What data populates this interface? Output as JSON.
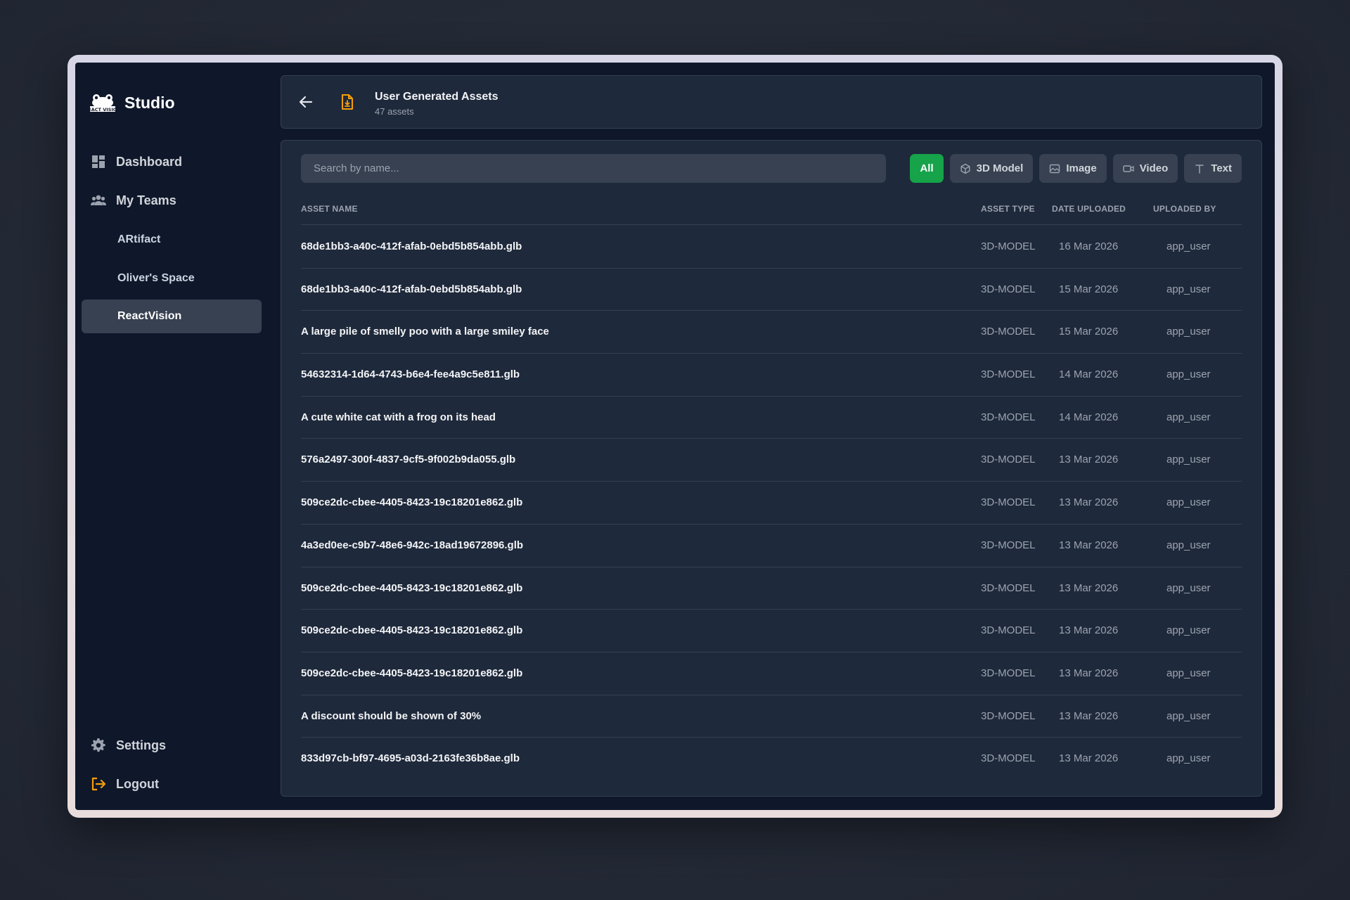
{
  "brand": {
    "name": "Studio",
    "logo_icon": "reactvision-logo"
  },
  "sidebar": {
    "nav": [
      {
        "label": "Dashboard",
        "icon": "dashboard-icon"
      },
      {
        "label": "My Teams",
        "icon": "teams-icon"
      }
    ],
    "teams": [
      {
        "label": "ARtifact",
        "active": false
      },
      {
        "label": "Oliver's Space",
        "active": false
      },
      {
        "label": "ReactVision",
        "active": true
      }
    ],
    "footer": [
      {
        "label": "Settings",
        "icon": "gear-icon"
      },
      {
        "label": "Logout",
        "icon": "logout-icon"
      }
    ]
  },
  "header": {
    "title": "User Generated Assets",
    "subtitle": "47 assets"
  },
  "search": {
    "placeholder": "Search by name...",
    "value": ""
  },
  "filters": [
    {
      "label": "All",
      "icon": "",
      "active": true
    },
    {
      "label": "3D Model",
      "icon": "cube-icon",
      "active": false
    },
    {
      "label": "Image",
      "icon": "image-icon",
      "active": false
    },
    {
      "label": "Video",
      "icon": "video-icon",
      "active": false
    },
    {
      "label": "Text",
      "icon": "text-icon",
      "active": false
    }
  ],
  "table": {
    "columns": [
      "ASSET NAME",
      "ASSET TYPE",
      "DATE UPLOADED",
      "UPLOADED BY"
    ],
    "rows": [
      {
        "name": "68de1bb3-a40c-412f-afab-0ebd5b854abb.glb",
        "type": "3D-MODEL",
        "date": "16 Mar 2026",
        "user": "app_user"
      },
      {
        "name": "68de1bb3-a40c-412f-afab-0ebd5b854abb.glb",
        "type": "3D-MODEL",
        "date": "15 Mar 2026",
        "user": "app_user"
      },
      {
        "name": "A large pile of smelly poo with a large smiley face",
        "type": "3D-MODEL",
        "date": "15 Mar 2026",
        "user": "app_user"
      },
      {
        "name": "54632314-1d64-4743-b6e4-fee4a9c5e811.glb",
        "type": "3D-MODEL",
        "date": "14 Mar 2026",
        "user": "app_user"
      },
      {
        "name": "A cute white cat with a frog on its head",
        "type": "3D-MODEL",
        "date": "14 Mar 2026",
        "user": "app_user"
      },
      {
        "name": "576a2497-300f-4837-9cf5-9f002b9da055.glb",
        "type": "3D-MODEL",
        "date": "13 Mar 2026",
        "user": "app_user"
      },
      {
        "name": "509ce2dc-cbee-4405-8423-19c18201e862.glb",
        "type": "3D-MODEL",
        "date": "13 Mar 2026",
        "user": "app_user"
      },
      {
        "name": "4a3ed0ee-c9b7-48e6-942c-18ad19672896.glb",
        "type": "3D-MODEL",
        "date": "13 Mar 2026",
        "user": "app_user"
      },
      {
        "name": "509ce2dc-cbee-4405-8423-19c18201e862.glb",
        "type": "3D-MODEL",
        "date": "13 Mar 2026",
        "user": "app_user"
      },
      {
        "name": "509ce2dc-cbee-4405-8423-19c18201e862.glb",
        "type": "3D-MODEL",
        "date": "13 Mar 2026",
        "user": "app_user"
      },
      {
        "name": "509ce2dc-cbee-4405-8423-19c18201e862.glb",
        "type": "3D-MODEL",
        "date": "13 Mar 2026",
        "user": "app_user"
      },
      {
        "name": "A discount should be shown of 30%",
        "type": "3D-MODEL",
        "date": "13 Mar 2026",
        "user": "app_user"
      },
      {
        "name": "833d97cb-bf97-4695-a03d-2163fe36b8ae.glb",
        "type": "3D-MODEL",
        "date": "13 Mar 2026",
        "user": "app_user"
      }
    ]
  },
  "colors": {
    "window_bg": "#0f172a",
    "card_bg": "#1e293b",
    "accent_green": "#16a34a",
    "icon_orange": "#f59e0b",
    "muted_text": "#9ca3af"
  }
}
